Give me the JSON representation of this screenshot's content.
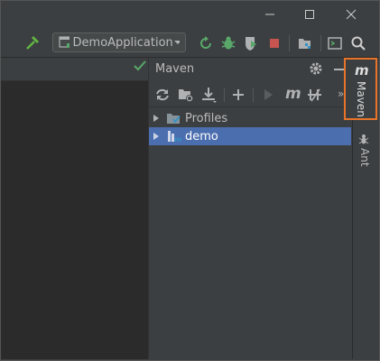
{
  "window": {
    "minimize_icon": "minimize-icon",
    "maximize_icon": "maximize-icon",
    "close_icon": "close-icon"
  },
  "toolbar": {
    "run_config": "DemoApplication",
    "build_icon": "hammer-icon",
    "rerun_icon": "rerun-icon",
    "debug_icon": "bug-icon",
    "coverage_icon": "coverage-icon",
    "stop_icon": "stop-icon",
    "project_structure_icon": "project-structure-icon",
    "terminal_icon": "terminal-icon",
    "search_icon": "search-icon"
  },
  "maven": {
    "title": "Maven",
    "tree": [
      {
        "label": "Profiles",
        "selected": false
      },
      {
        "label": "demo",
        "selected": true
      }
    ]
  },
  "side_tabs": {
    "maven_label": "Maven",
    "maven_glyph": "m",
    "ant_label": "Ant"
  },
  "colors": {
    "accent_highlight": "#e8742a",
    "selection": "#4b6eaf",
    "checkmark": "#59a869",
    "stop": "#c75450"
  }
}
